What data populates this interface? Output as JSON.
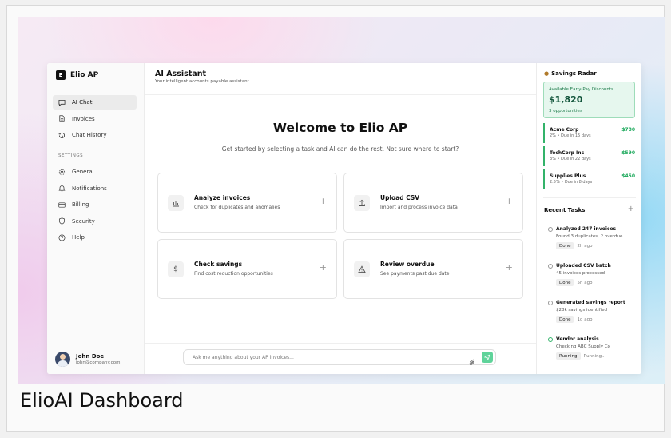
{
  "sidebar": {
    "brand": {
      "mark": "E",
      "name": "Elio AP"
    },
    "nav": [
      {
        "label": "AI Chat",
        "icon": "chat-icon",
        "active": true
      },
      {
        "label": "Invoices",
        "icon": "document-icon",
        "active": false
      },
      {
        "label": "Chat History",
        "icon": "history-icon",
        "active": false
      }
    ],
    "settings_label": "SETTINGS",
    "settings": [
      {
        "label": "General",
        "icon": "gear-icon"
      },
      {
        "label": "Notifications",
        "icon": "bell-icon"
      },
      {
        "label": "Billing",
        "icon": "credit-card-icon"
      },
      {
        "label": "Security",
        "icon": "shield-icon"
      },
      {
        "label": "Help",
        "icon": "help-icon"
      }
    ],
    "user": {
      "name": "John Doe",
      "email": "john@company.com"
    }
  },
  "main": {
    "title": "AI Assistant",
    "subtitle": "Your intelligent accounts payable assistant",
    "welcome": "Welcome to Elio AP",
    "welcome_sub": "Get started by selecting a task and AI can do the rest. Not sure where to start?",
    "cards": [
      {
        "title": "Analyze invoices",
        "desc": "Check for duplicates and anomalies",
        "icon": "bar-chart-icon"
      },
      {
        "title": "Upload CSV",
        "desc": "Import and process invoice data",
        "icon": "upload-icon"
      },
      {
        "title": "Check savings",
        "desc": "Find cost reduction opportunities",
        "icon": "dollar-icon"
      },
      {
        "title": "Review overdue",
        "desc": "See payments past due date",
        "icon": "warning-icon"
      }
    ],
    "chat_placeholder": "Ask me anything about your AP invoices..."
  },
  "radar": {
    "title": "Savings Radar",
    "early_label": "Available Early-Pay Discounts",
    "early_amount": "$1,820",
    "early_opps": "3 opportunities",
    "vendors": [
      {
        "name": "Acme Corp",
        "meta": "2% • Due in 15 days",
        "amount": "$780"
      },
      {
        "name": "TechCorp Inc",
        "meta": "3% • Due in 22 days",
        "amount": "$590"
      },
      {
        "name": "Supplies Plus",
        "meta": "2.5% • Due in 8 days",
        "amount": "$450"
      }
    ]
  },
  "tasks": {
    "title": "Recent Tasks",
    "items": [
      {
        "title": "Analyzed 247 invoices",
        "detail": "Found 3 duplicates, 2 overdue",
        "status": "Done",
        "time": "2h ago"
      },
      {
        "title": "Uploaded CSV batch",
        "detail": "45 invoices processed",
        "status": "Done",
        "time": "5h ago"
      },
      {
        "title": "Generated savings report",
        "detail": "$28k savings identified",
        "status": "Done",
        "time": "1d ago"
      },
      {
        "title": "Vendor analysis",
        "detail": "Checking ABC Supply Co",
        "status": "Running",
        "time": "Running..."
      }
    ]
  },
  "caption": "ElioAI Dashboard",
  "colors": {
    "accent": "#5fd39a",
    "savings_green": "#1aa85a",
    "early_bg": "#e6f7ee"
  }
}
